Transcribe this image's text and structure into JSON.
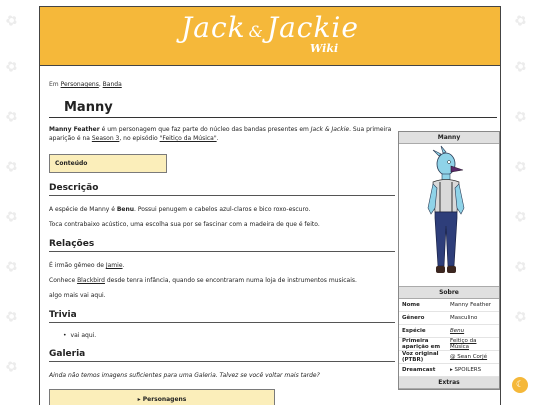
{
  "site": {
    "logo_title": "Jack",
    "logo_amp": "&",
    "logo_title2": "Jackie",
    "logo_sub": "Wiki"
  },
  "breadcrumb": {
    "prefix": "Em",
    "items": [
      "Personagens",
      "Banda"
    ]
  },
  "page_title": "Manny",
  "intro": {
    "name": "Manny Feather",
    "text1": " é um personagem que faz parte do núcleo das bandas presentes em ",
    "show": "Jack & Jackie",
    "text2": ". Sua primeira aparição é na ",
    "season": "Season 3",
    "text3": ", no episódio ",
    "episode": "\"Feitiço da Música\"",
    "text4": "."
  },
  "toc": {
    "label": "Conteúdo"
  },
  "sections": {
    "descricao": {
      "title": "Descrição",
      "p1_a": "A espécie de Manny é ",
      "p1_b": "Benu",
      "p1_c": ". Possui penugem e cabelos azul-claros e bico roxo-escuro.",
      "p2": "Toca contrabaixo acústico, uma escolha sua por se fascinar com a madeira de que é feito."
    },
    "relacoes": {
      "title": "Relações",
      "p1_a": "É irmão gêmeo de ",
      "p1_link": "Jamie",
      "p1_c": ".",
      "p2_a": "Conhece ",
      "p2_link": "Blackbird",
      "p2_c": " desde tenra infância, quando se encontraram numa loja de instrumentos musicais.",
      "p3": "algo mais vai aqui."
    },
    "trivia": {
      "title": "Trivia",
      "items": [
        "vai aqui."
      ]
    },
    "galeria": {
      "title": "Galeria",
      "note": "Ainda não temos imagens suficientes para uma Galeria. Talvez se você voltar mais tarde?",
      "toggle": "▸ Personagens"
    }
  },
  "infobox": {
    "title": "Manny",
    "about_header": "Sobre",
    "rows": [
      {
        "key": "Nome",
        "value": "Manny Feather"
      },
      {
        "key": "Gênero",
        "value": "Masculino"
      },
      {
        "key": "Espécie",
        "value": "Benu"
      },
      {
        "key": "Primeira aparição em",
        "value": "Feitiço da Música"
      },
      {
        "key": "Voz original (PTBR)",
        "value": "@ Sean Corjé"
      },
      {
        "key": "Dreamcast",
        "value": "▸ SPOILERS"
      }
    ],
    "extras_header": "Extras"
  },
  "colors": {
    "accent": "#f5b83a",
    "toc_bg": "#fbeeba"
  },
  "icons": {
    "night_mode": "moon-icon"
  }
}
